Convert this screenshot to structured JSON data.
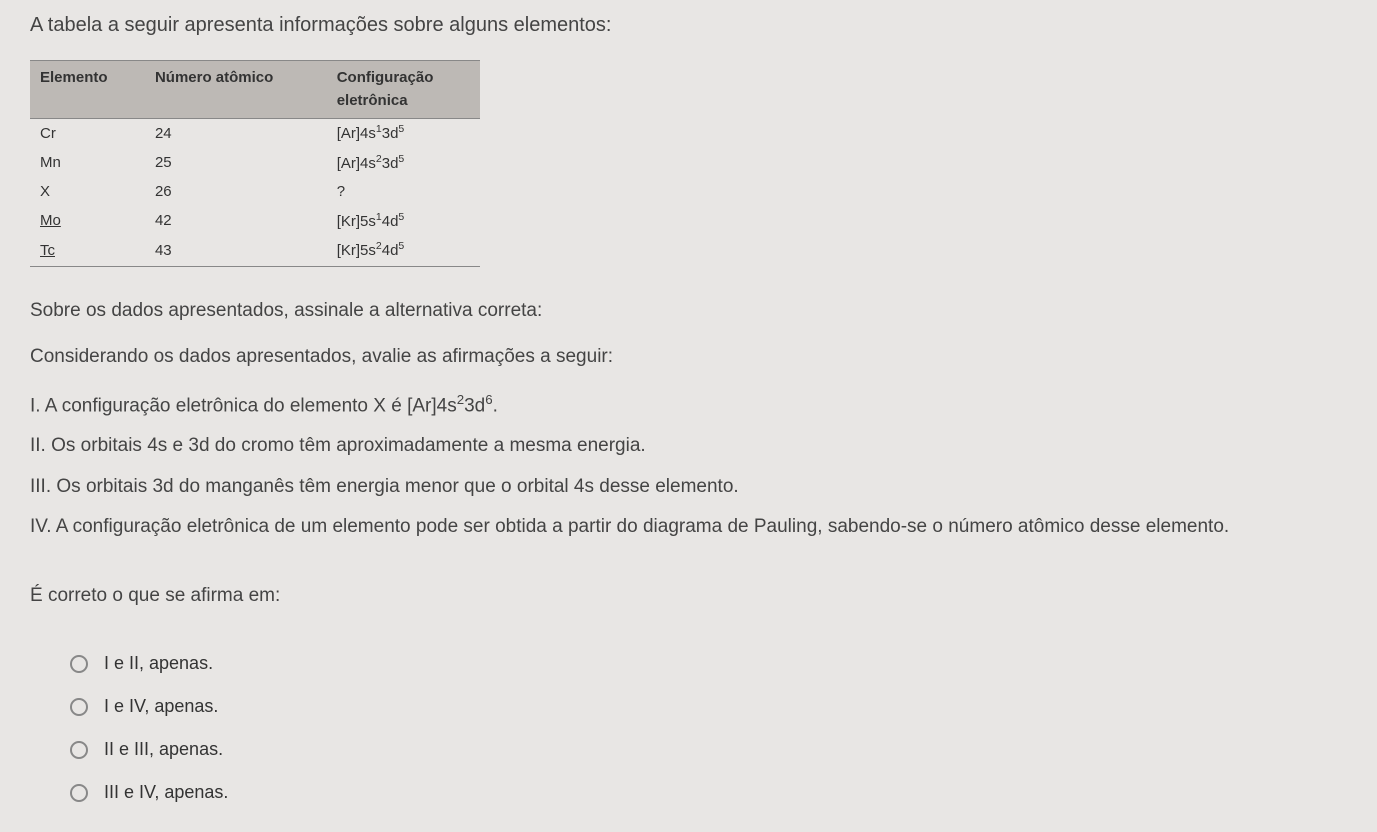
{
  "intro": "A tabela a seguir apresenta informações sobre alguns elementos:",
  "table": {
    "headers": {
      "col1": "Elemento",
      "col2": "Número atômico",
      "col3_line1": "Configuração",
      "col3_line2": "eletrônica"
    },
    "rows": [
      {
        "element": "Cr",
        "underlined": false,
        "atomic": "24",
        "config_html": "[Ar]4s<sup>1</sup>3d<sup>5</sup>"
      },
      {
        "element": "Mn",
        "underlined": false,
        "atomic": "25",
        "config_html": "[Ar]4s<sup>2</sup>3d<sup>5</sup>"
      },
      {
        "element": "X",
        "underlined": false,
        "atomic": "26",
        "config_html": "?"
      },
      {
        "element": "Mo",
        "underlined": true,
        "atomic": "42",
        "config_html": "[Kr]5s<sup>1</sup>4d<sup>5</sup>"
      },
      {
        "element": "Tc",
        "underlined": true,
        "atomic": "43",
        "config_html": "[Kr]5s<sup>2</sup>4d<sup>5</sup>"
      }
    ]
  },
  "prompt1": "Sobre os dados apresentados, assinale a alternativa correta:",
  "prompt2": "Considerando os dados apresentados, avalie as afirmações a seguir:",
  "statements": {
    "s1_html": "I. A configuração eletrônica do elemento X é [Ar]4s<sup>2</sup>3d<sup>6</sup>.",
    "s2": "II. Os orbitais 4s e 3d do cromo têm aproximadamente a mesma energia.",
    "s3": "III. Os orbitais 3d do manganês têm energia menor que o orbital 4s desse elemento.",
    "s4": "IV. A configuração eletrônica de um elemento pode ser obtida a partir do diagrama de Pauling, sabendo-se o número atômico desse elemento."
  },
  "conclusion_prompt": "É correto o que se afirma em:",
  "options": [
    "I e II, apenas.",
    "I e IV, apenas.",
    "II e III, apenas.",
    "III e IV, apenas."
  ]
}
